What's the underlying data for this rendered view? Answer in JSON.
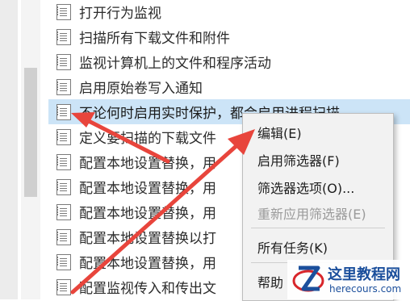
{
  "policy_list": {
    "items": [
      {
        "label": "打开行为监视",
        "selected": false
      },
      {
        "label": "扫描所有下载文件和附件",
        "selected": false
      },
      {
        "label": "监视计算机上的文件和程序活动",
        "selected": false
      },
      {
        "label": "启用原始卷写入通知",
        "selected": false
      },
      {
        "label": "不论何时启用实时保护，都会启用进程扫描",
        "selected": true
      },
      {
        "label": "定义要扫描的下载文件",
        "selected": false
      },
      {
        "label": "配置本地设置替换，用",
        "selected": false
      },
      {
        "label": "配置本地设置替换，用",
        "selected": false
      },
      {
        "label": "配置本地设置替换，用",
        "selected": false
      },
      {
        "label": "配置本地设置替换以打",
        "selected": false
      },
      {
        "label": "配置本地设置替换，用",
        "selected": false
      },
      {
        "label": "配置监视传入和传出文",
        "selected": false
      }
    ]
  },
  "context_menu": {
    "edit": "编辑(E)",
    "enable_filter": "启用筛选器(F)",
    "filter_options": "筛选器选项(O)...",
    "reapply_filter": "重新应用筛选器(E)",
    "all_tasks": "所有任务(K)",
    "help": "帮助"
  },
  "watermark": {
    "title": "这里教程网",
    "url": "herecours.com"
  },
  "colors": {
    "selection": "#cce4f7",
    "arrow": "#e8453c",
    "watermark_blue": "#1b4f9c",
    "watermark_red": "#d8262b"
  }
}
